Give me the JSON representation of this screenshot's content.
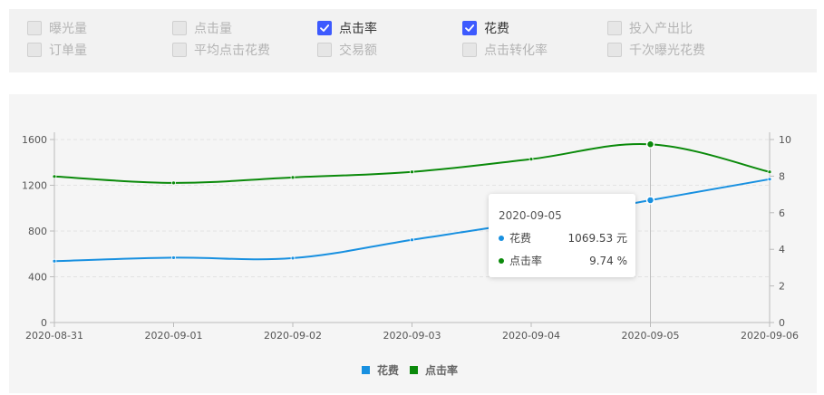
{
  "metrics": [
    {
      "label": "曝光量",
      "checked": false
    },
    {
      "label": "点击量",
      "checked": false
    },
    {
      "label": "点击率",
      "checked": true
    },
    {
      "label": "花费",
      "checked": true
    },
    {
      "label": "投入产出比",
      "checked": false
    },
    {
      "label": "订单量",
      "checked": false
    },
    {
      "label": "平均点击花费",
      "checked": false
    },
    {
      "label": "交易额",
      "checked": false
    },
    {
      "label": "点击转化率",
      "checked": false
    },
    {
      "label": "千次曝光花费",
      "checked": false
    }
  ],
  "tooltip": {
    "date": "2020-09-05",
    "rows": [
      {
        "name": "花费",
        "value": "1069.53 元"
      },
      {
        "name": "点击率",
        "value": "9.74 %"
      }
    ]
  },
  "chart_data": {
    "type": "line",
    "x": [
      "2020-08-31",
      "2020-09-01",
      "2020-09-02",
      "2020-09-03",
      "2020-09-04",
      "2020-09-05",
      "2020-09-06"
    ],
    "left_axis": {
      "ylim": [
        0,
        1600
      ],
      "ticks": [
        0,
        400,
        800,
        1200,
        1600
      ]
    },
    "right_axis": {
      "ylim": [
        0,
        10
      ],
      "ticks": [
        0,
        2,
        4,
        6,
        8,
        10
      ]
    },
    "series": [
      {
        "name": "花费",
        "axis": "left",
        "color": "#1890e0",
        "values": [
          537,
          567,
          563,
          723,
          885,
          1069.53,
          1253
        ]
      },
      {
        "name": "点击率",
        "axis": "right",
        "color": "#0b8a0b",
        "values": [
          7.98,
          7.63,
          7.93,
          8.23,
          8.93,
          9.74,
          8.23
        ]
      }
    ],
    "highlight": "2020-09-05",
    "grid": true,
    "legend": "bottom-center"
  }
}
